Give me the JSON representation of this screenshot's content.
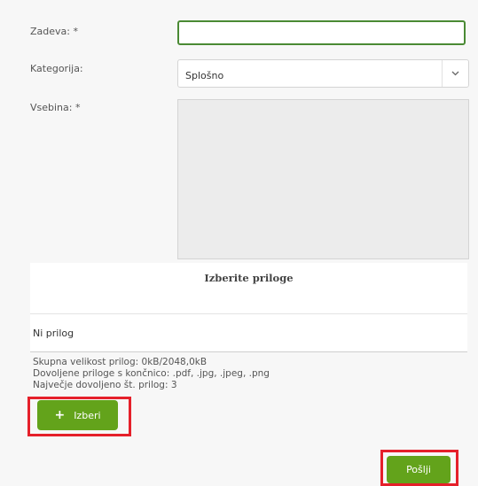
{
  "form": {
    "subject_label": "Zadeva: *",
    "subject_value": "",
    "category_label": "Kategorija:",
    "category_value": "Splošno",
    "content_label": "Vsebina: *",
    "content_value": ""
  },
  "attachments": {
    "title": "Izberite priloge",
    "empty_text": "Ni prilog",
    "total_size": "Skupna velikost prilog: 0kB/2048,0kB",
    "allowed_ext": "Dovoljene priloge s končnico: .pdf, .jpg, .jpeg, .png",
    "max_count": "Največje dovoljeno št. prilog: 3"
  },
  "buttons": {
    "choose_icon": "+",
    "choose_label": "Izberi",
    "send_label": "Pošlji"
  },
  "highlight_color": "#e5202a",
  "accent_color": "#63a31b"
}
